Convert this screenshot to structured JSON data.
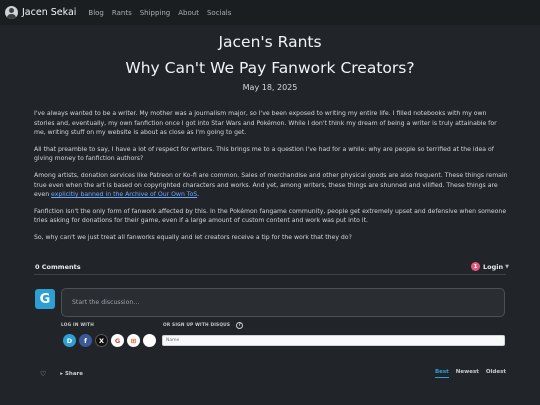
{
  "navbar": {
    "brand": "Jacen Sekai",
    "links": [
      "Blog",
      "Rants",
      "Shipping",
      "About",
      "Socials"
    ]
  },
  "header": {
    "site_title": "Jacen's Rants",
    "post_title": "Why Can't We Pay Fanwork Creators?",
    "date": "May 18, 2025"
  },
  "article": {
    "p1": "I've always wanted to be a writer. My mother was a journalism major, so I've been exposed to writing my entire life. I filled notebooks with my own stories and, eventually, my own fanfiction once I got into Star Wars and Pokémon. While I don't think my dream of being a writer is truly attainable for me, writing stuff on my website is about as close as I'm going to get.",
    "p2": "All that preamble to say, I have a lot of respect for writers. This brings me to a question I've had for a while: why are people so terrified at the idea of giving money to fanfiction authors?",
    "p3_before": "Among artists, donation services like Patreon or Ko-fi are common. Sales of merchandise and other physical goods are also frequent. These things remain true even when the art is based on copyrighted characters and works. And yet, among writers, these things are shunned and vilified. These things are even ",
    "p3_link": "explicitly banned in the Archive of Our Own ToS",
    "p3_after": ".",
    "p4": "Fanfiction isn't the only form of fanwork affected by this. In the Pokémon fangame community, people get extremely upset and defensive when someone tries asking for donations for their game, even if a large amount of custom content and work was put into it.",
    "p5": "So, why can't we just treat all fanworks equally and let creators receive a tip for the work that they do?"
  },
  "comments": {
    "count_label": "0 Comments",
    "notification_count": "1",
    "login_label": "Login",
    "guest_initial": "G",
    "placeholder": "Start the discussion…",
    "login_with_label": "LOG IN WITH",
    "sso_label": "OR SIGN UP WITH DISQUS",
    "help_glyph": "?",
    "name_placeholder": "Name",
    "share_label": "Share",
    "sort_options": [
      "Best",
      "Newest",
      "Oldest"
    ],
    "social_providers": [
      {
        "name": "disqus",
        "glyph": "D",
        "color": "#2e9fd3"
      },
      {
        "name": "facebook",
        "glyph": "f",
        "color": "#3b5998"
      },
      {
        "name": "x",
        "glyph": "X",
        "color": "#111111"
      },
      {
        "name": "google",
        "glyph": "G",
        "color": "#ffffff"
      },
      {
        "name": "microsoft",
        "glyph": "⊞",
        "color": "#ffffff"
      },
      {
        "name": "apple",
        "glyph": "",
        "color": "#ffffff"
      }
    ]
  }
}
